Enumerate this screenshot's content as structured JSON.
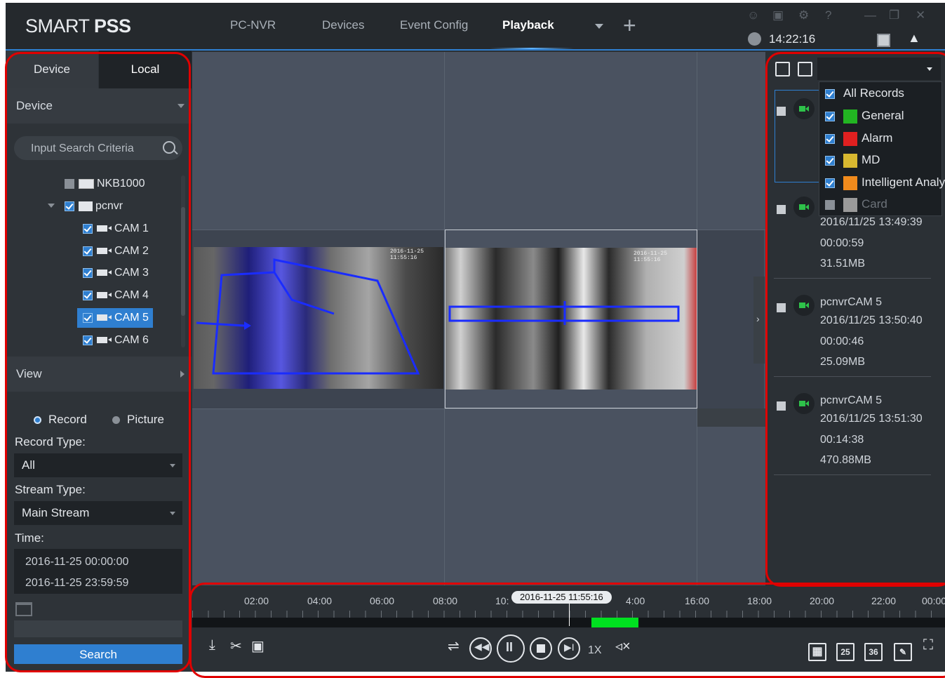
{
  "app": {
    "brand_prefix": "SMART ",
    "brand_bold": "PSS",
    "nav": [
      "PC-NVR",
      "Devices",
      "Event Config",
      "Playback"
    ],
    "active_nav": "Playback",
    "clock": "14:22:16"
  },
  "left_panel": {
    "tabs": [
      "Device",
      "Local"
    ],
    "device_section": "Device",
    "search_placeholder": "Input Search Criteria",
    "tree": [
      {
        "label": "NKB1000",
        "checked": false,
        "kind": "nvr"
      },
      {
        "label": "pcnvr",
        "checked": true,
        "kind": "pcnvr"
      },
      {
        "label": "CAM 1",
        "checked": true,
        "kind": "cam"
      },
      {
        "label": "CAM 2",
        "checked": true,
        "kind": "cam"
      },
      {
        "label": "CAM 3",
        "checked": true,
        "kind": "cam"
      },
      {
        "label": "CAM 4",
        "checked": true,
        "kind": "cam-smart"
      },
      {
        "label": "CAM 5",
        "checked": true,
        "kind": "cam-smart",
        "selected": true
      },
      {
        "label": "CAM 6",
        "checked": true,
        "kind": "cam"
      }
    ],
    "view_section": "View",
    "radio_record": "Record",
    "radio_picture": "Picture",
    "record_type_label": "Record Type:",
    "record_type_value": "All",
    "stream_type_label": "Stream Type:",
    "stream_type_value": "Main Stream",
    "time_label": "Time:",
    "time_start": "2016-11-25 00:00:00",
    "time_end": "2016-11-25 23:59:59",
    "search_button": "Search"
  },
  "record_filter": {
    "items": [
      {
        "label": "All Records",
        "checked": true,
        "color": null
      },
      {
        "label": "General",
        "checked": true,
        "color": "#22b522"
      },
      {
        "label": "Alarm",
        "checked": true,
        "color": "#e02020"
      },
      {
        "label": "MD",
        "checked": true,
        "color": "#d8b830"
      },
      {
        "label": "Intelligent Analy",
        "checked": true,
        "color": "#f08a1c"
      },
      {
        "label": "Card",
        "checked": false,
        "color": "#9a9a9a"
      }
    ]
  },
  "records": [
    {
      "name": "",
      "start": "2016/11/25 13:49:39",
      "duration": "00:00:59",
      "size": "31.51MB"
    },
    {
      "name": "pcnvrCAM 5",
      "start": "2016/11/25 13:50:40",
      "duration": "00:00:46",
      "size": "25.09MB"
    },
    {
      "name": "pcnvrCAM 5",
      "start": "2016/11/25 13:51:30",
      "duration": "00:14:38",
      "size": "470.88MB"
    }
  ],
  "timeline": {
    "labels": [
      "02:00",
      "04:00",
      "06:00",
      "08:00",
      "10:",
      "4:00",
      "16:00",
      "18:00",
      "20:00",
      "22:00",
      "00:00"
    ],
    "cursor_time": "2016-11-25 11:55:16",
    "speed": "1X",
    "grid_options": [
      "25",
      "36"
    ]
  },
  "video": {
    "cam1_overlay_ts": "2016-11-25 11:55:16",
    "cam2_overlay_ts": "2016-11-25 11:55:16"
  }
}
